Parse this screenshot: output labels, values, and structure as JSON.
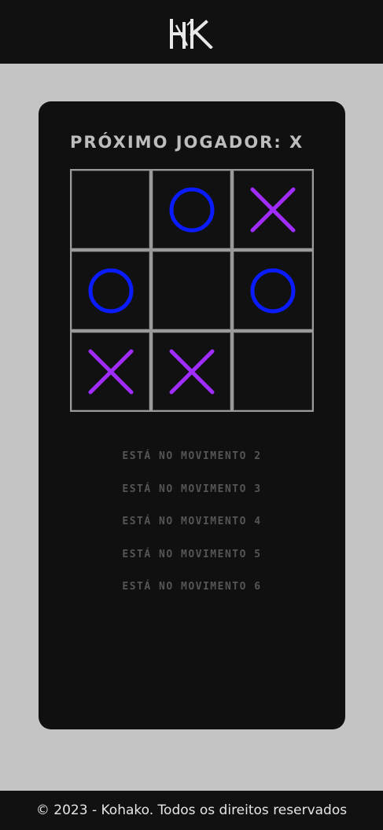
{
  "header": {
    "logo_text": "HK"
  },
  "game": {
    "status": "PRÓXIMO JOGADOR: X",
    "board": [
      "",
      "O",
      "X",
      "O",
      "",
      "O",
      "X",
      "X",
      ""
    ],
    "colors": {
      "x": "#a02cff",
      "o": "#0a1cff"
    }
  },
  "moves": [
    "ESTÁ NO MOVIMENTO 2",
    "ESTÁ NO MOVIMENTO 3",
    "ESTÁ NO MOVIMENTO 4",
    "ESTÁ NO MOVIMENTO 5",
    "ESTÁ NO MOVIMENTO 6"
  ],
  "footer": {
    "text": "© 2023 - Kohako. Todos os direitos reservados"
  }
}
